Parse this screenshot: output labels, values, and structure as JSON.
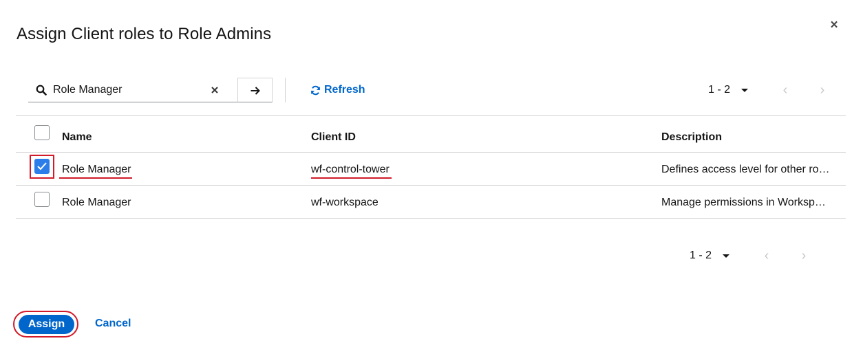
{
  "dialog": {
    "title": "Assign Client roles to Role Admins",
    "close_label": "×"
  },
  "toolbar": {
    "search_value": "Role Manager",
    "search_icon": "search-icon",
    "clear_icon": "close-icon",
    "go_icon": "arrow-right-icon",
    "refresh_label": "Refresh",
    "refresh_icon": "sync-icon"
  },
  "pagination_top": {
    "range": "1 - 2",
    "prev": "‹",
    "next": "›"
  },
  "pagination_bottom": {
    "range": "1 - 2",
    "prev": "‹",
    "next": "›"
  },
  "table": {
    "headers": {
      "name": "Name",
      "client_id": "Client ID",
      "description": "Description"
    },
    "rows": [
      {
        "name": "Role Manager",
        "client_id": "wf-control-tower",
        "description": "Defines access level for other ro…",
        "checked": true
      },
      {
        "name": "Role Manager",
        "client_id": "wf-workspace",
        "description": "Manage permissions in Worksp…",
        "checked": false
      }
    ]
  },
  "footer": {
    "assign_label": "Assign",
    "cancel_label": "Cancel"
  },
  "colors": {
    "accent": "#0066cc",
    "highlight": "#d11a2a",
    "checkbox_checked": "#2b7de9"
  }
}
